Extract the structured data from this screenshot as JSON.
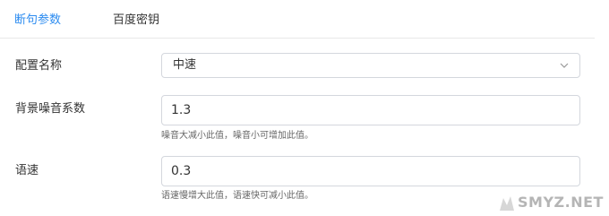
{
  "tabs": [
    {
      "label": "断句参数",
      "active": true
    },
    {
      "label": "百度密钥",
      "active": false
    }
  ],
  "form": {
    "config_name": {
      "label": "配置名称",
      "value": "中速"
    },
    "noise": {
      "label": "背景噪音系数",
      "value": "1.3",
      "hint": "噪音大减小此值，噪音小可增加此值。"
    },
    "speed": {
      "label": "语速",
      "value": "0.3",
      "hint": "语速慢增大此值，语速快可减小此值。"
    }
  },
  "watermark": {
    "text": "SMYZ.NET"
  },
  "colors": {
    "accent": "#2d8cf0",
    "border": "#d4d7dd",
    "text": "#333333",
    "hint": "#666666"
  },
  "icons": {
    "select_arrow": "chevron-down-icon",
    "watermark_logo": "smyz-logo-icon"
  }
}
